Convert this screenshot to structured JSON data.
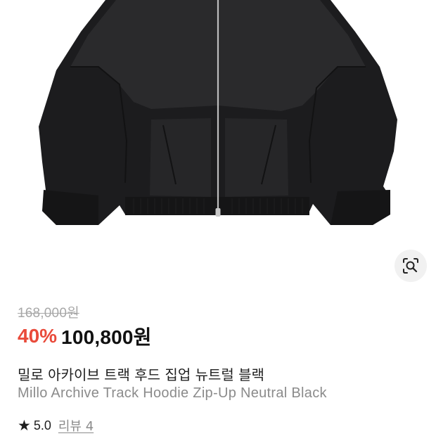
{
  "product": {
    "image_alt": "black track hoodie zip-up jacket",
    "original_price": "168,000원",
    "discount_rate": "40%",
    "sale_price": "100,800원",
    "name_ko": "밀로 아카이브 트랙 후드 집업 뉴트럴 블랙",
    "name_en": "Millo Archive Track Hoodie Zip-Up Neutral Black"
  },
  "rating": {
    "star_icon": "star-icon",
    "value": "5.0"
  },
  "reviews": {
    "label": "리뷰 4"
  },
  "actions": {
    "lens_icon": "image-search-icon"
  },
  "colors": {
    "discount": "#e94a3a",
    "text": "#1f1f1f",
    "muted": "#8b8b8b",
    "strike": "#a7a7a7"
  }
}
